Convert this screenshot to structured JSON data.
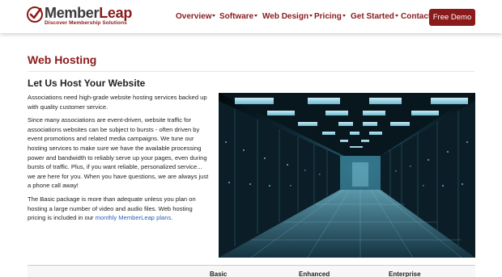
{
  "brand": {
    "name_part1": "Member",
    "name_part2": "Leap",
    "tagline": "Discover Membership Solutions"
  },
  "nav": {
    "items": [
      {
        "label": "Overview",
        "has_dropdown": true
      },
      {
        "label": "Software",
        "has_dropdown": true
      },
      {
        "label": "Web Design",
        "has_dropdown": true
      },
      {
        "label": "Pricing",
        "has_dropdown": true
      },
      {
        "label": "Get Started",
        "has_dropdown": true
      },
      {
        "label": "Contact",
        "has_dropdown": false
      }
    ],
    "cta_label": "Free Demo"
  },
  "page": {
    "title": "Web Hosting",
    "section_title": "Let Us Host Your Website",
    "paragraphs": [
      "Associations need high-grade website hosting services backed up with quality customer service.",
      "Since many associations are event-driven, website traffic for associations websites can be subject to bursts - often driven by event promotions and related media campaigns. We tune our hosting services to make sure we have the available processing power and bandwidth to reliably serve up your pages, even during bursts of traffic. Plus, if you want reliable, personalized service... we are here for you. When you have questions, we are always just a phone call away!"
    ],
    "last_paragraph_text": "The Basic package is more than adequate unless you plan on hosting a large number of video and audio files. Web hosting pricing is included in our ",
    "last_paragraph_link": "monthly MemberLeap plans."
  },
  "pricing_table": {
    "columns": [
      "Basic",
      "Enhanced",
      "Enterprise"
    ]
  },
  "colors": {
    "brand_red": "#8b1a1a",
    "link_blue": "#2a62b8",
    "server_glow": "#7fd8f0"
  }
}
